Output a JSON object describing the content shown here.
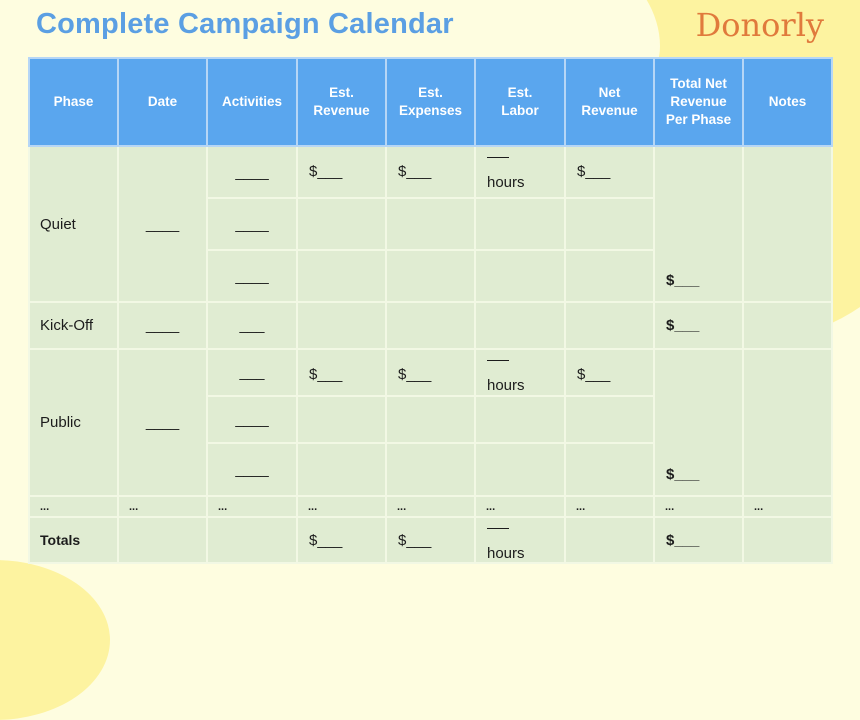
{
  "header": {
    "title": "Complete Campaign Calendar",
    "brand": "Donorly"
  },
  "colors": {
    "title": "#5b9fe3",
    "brand": "#e07a3c",
    "header_bg": "#5aa6ee",
    "cell_bg": "#e0ecd2",
    "page_bg": "#fefde0",
    "accent_blob": "#fdf3a0"
  },
  "table": {
    "columns": [
      "Phase",
      "Date",
      "Activities",
      "Est. Revenue",
      "Est. Expenses",
      "Est. Labor",
      "Net Revenue",
      "Total Net Revenue Per Phase",
      "Notes"
    ],
    "phases": {
      "quiet": {
        "name": "Quiet",
        "date": "____",
        "activities": [
          "____",
          "____",
          "____"
        ],
        "est_revenue": "$___",
        "est_expenses": "$___",
        "est_labor_unit": "hours",
        "net_revenue": "$___",
        "total_net": "$___"
      },
      "kickoff": {
        "name": "Kick-Off",
        "date": "____",
        "activities": [
          "___"
        ],
        "total_net": "$___"
      },
      "public": {
        "name": "Public",
        "date": "____",
        "activities": [
          "___",
          "____",
          "____"
        ],
        "est_revenue": "$___",
        "est_expenses": "$___",
        "est_labor_unit": "hours",
        "net_revenue": "$___",
        "total_net": "$___"
      }
    },
    "ellipsis": "...",
    "totals": {
      "label": "Totals",
      "est_revenue": "$___",
      "est_expenses": "$___",
      "est_labor_unit": "hours",
      "total_net": "$___"
    }
  }
}
